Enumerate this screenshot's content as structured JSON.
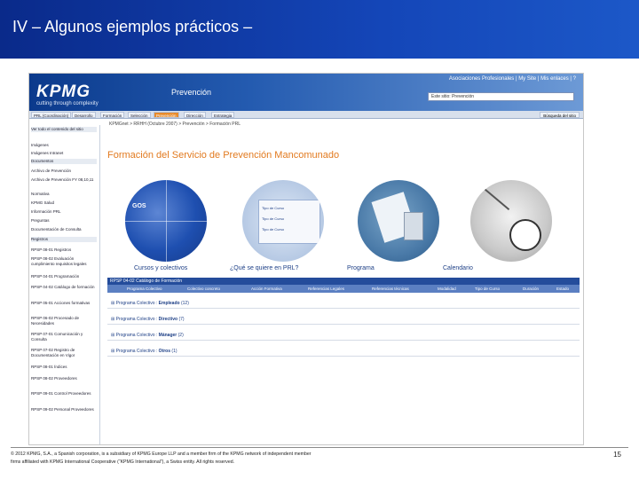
{
  "slide": {
    "title": "IV – Algunos ejemplos prácticos –",
    "footer_line1": "© 2012 KPMG, S.A., a Spanish corporation, is a subsidiary of KPMG Europe LLP and a member firm of the KPMG network of independent member",
    "footer_line2": "firms affiliated with KPMG International Cooperative (“KPMG International”), a Swiss entity. All rights reserved.",
    "page_number": "15"
  },
  "app": {
    "logo": "KPMG",
    "tagline": "cutting through complexity",
    "site_title": "Prevención",
    "user_links": "Asociaciones Profesionales  |  My Site  |  Mis enlaces  |  ?",
    "search_placeholder": "Este sitio: Prevención",
    "nav_tabs": [
      "PRL (Coordinación)",
      "Desarrollo",
      "Formación",
      "Selección",
      "Prevención",
      "Dirección",
      "Estrategia"
    ],
    "nav_active_index": 4,
    "nav_right": "Búsqueda del sitio",
    "breadcrumb": "KPMGnet > RRHH (Octubre 2007) > Prevención > Formación PRL",
    "sidebar_items": [
      "Ver todo el contenido del sitio",
      "Imágenes",
      "Imágenes Intranet",
      "Documentos",
      "Archivo de Prevención",
      "Archivo de Prevención FY 08,10,11",
      "Normativa",
      "KPMG Salud",
      "Información PRL",
      "Preguntas",
      "Documentación de Consulta",
      "Registros",
      "RPSP 08-01 Registros",
      "RPSP 08-02 Evaluación cumplimiento requisitos legales",
      "RPSP 04-01 Programación",
      "RPSP 04-02 Catálogo de formación",
      "RPSP 05-01 Acciones formativas",
      "RPSP 06-02 Procesado de Necesidades",
      "RPSP 07-01 Comunicación y Consulta",
      "RPSP 07-02 Registro de Documentación en Vigor",
      "RPSP 08-01 Índices",
      "RPSP 08-02 Proveedores",
      "RPSP 09-01 Control Proveedores",
      "RPSP 09-02 Personal Proveedores"
    ],
    "page_title": "Formación del Servicio de Prevención Mancomunado",
    "thumbs": [
      {
        "label": "Cursos y colectivos",
        "inner": "GOS"
      },
      {
        "label": "¿Qué se quiere en PRL?",
        "inner": "Tipo de Curso"
      },
      {
        "label": "Programa",
        "inner": ""
      },
      {
        "label": "Calendario",
        "inner": ""
      }
    ],
    "catalog_title": "RPSP 04-02 Catálogo de Formación",
    "catalog_columns": [
      "Programa Colectivo",
      "Colectivo concreto",
      "Acción Formativa",
      "Referencias Legales",
      "Referencias técnicas",
      "Modalidad",
      "Tipo de Curso",
      "Duración",
      "Estado"
    ],
    "catalog_rows": [
      {
        "prefix": "Programa Colectivo : ",
        "name": "Empleado",
        "count": "(12)"
      },
      {
        "prefix": "Programa Colectivo : ",
        "name": "Directivo",
        "count": "(7)"
      },
      {
        "prefix": "Programa Colectivo : ",
        "name": "Mánager",
        "count": "(2)"
      },
      {
        "prefix": "Programa Colectivo : ",
        "name": "Otros",
        "count": "(1)"
      }
    ]
  },
  "colors": {
    "header_blue": "#1446b8",
    "accent_orange": "#e27a1f",
    "link_blue": "#1d3f86"
  }
}
